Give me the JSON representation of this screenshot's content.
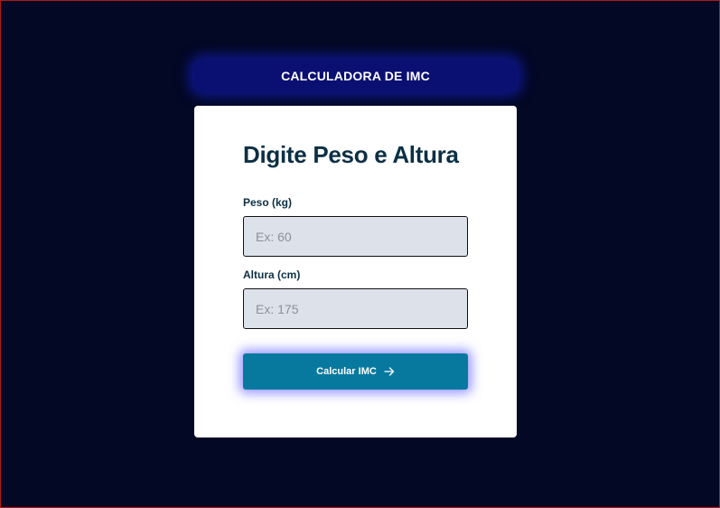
{
  "header": {
    "title": "CALCULADORA DE IMC"
  },
  "form": {
    "heading": "Digite Peso e Altura",
    "weight": {
      "label": "Peso (kg)",
      "placeholder": "Ex: 60",
      "value": ""
    },
    "height": {
      "label": "Altura (cm)",
      "placeholder": "Ex: 175",
      "value": ""
    },
    "submit": {
      "label": "Calcular IMC",
      "icon": "arrow-right-icon"
    }
  },
  "colors": {
    "background": "#030824",
    "header_glow": "#0a0f72",
    "heading_text": "#0c2f44",
    "input_background": "#dde2ea",
    "button_background": "#07799f",
    "button_glow": "#5a5aff"
  }
}
